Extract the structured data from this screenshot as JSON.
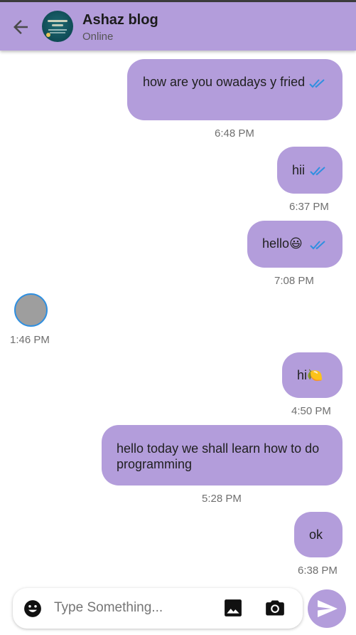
{
  "header": {
    "title": "Ashaz blog",
    "status": "Online"
  },
  "messages": [
    {
      "text": "how are you owadays y fried",
      "time": "6:48 PM",
      "read": true
    },
    {
      "text": "hii",
      "time": "6:37 PM",
      "read": true
    },
    {
      "text": "hello😃",
      "time": "7:08 PM",
      "read": true
    },
    {
      "time": "1:46 PM"
    },
    {
      "text": "hi🍋",
      "time": "4:50 PM"
    },
    {
      "text": "hello today we shall learn how to do programming",
      "time": "5:28 PM"
    },
    {
      "text": "ok",
      "time": "6:38 PM"
    }
  ],
  "input": {
    "placeholder": "Type Something..."
  },
  "icons": {
    "back": "arrow-back-icon",
    "emoji": "emoji-icon",
    "image": "image-icon",
    "camera": "camera-icon",
    "send": "send-icon",
    "read": "double-check-icon"
  },
  "colors": {
    "accent": "#b39ddb",
    "read_tick": "#2f8fe0"
  }
}
